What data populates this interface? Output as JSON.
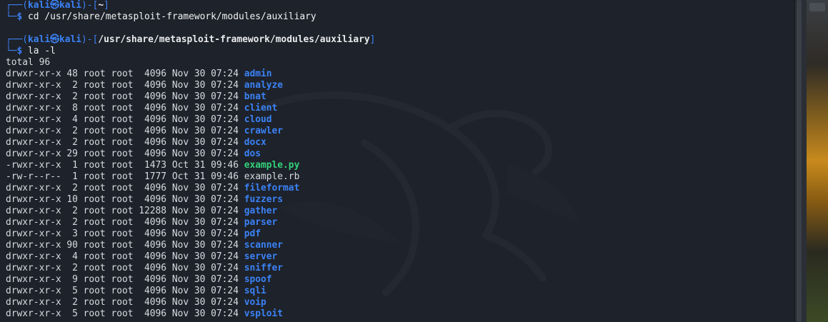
{
  "prompt1": {
    "corner_top": "┌──(",
    "user": "kali㉿kali",
    "sep": ")-[",
    "path": "~",
    "close": "]",
    "corner_bottom": "└─$ ",
    "command": "cd /usr/share/metasploit-framework/modules/auxiliary"
  },
  "prompt2": {
    "corner_top": "┌──(",
    "user": "kali㉿kali",
    "sep": ")-[",
    "path": "/usr/share/metasploit-framework/modules/auxiliary",
    "close": "]",
    "corner_bottom": "└─$ ",
    "command": "la -l"
  },
  "total": "total 96",
  "listing": [
    {
      "meta": "drwxr-xr-x 48 root root  4096 Nov 30 07:24 ",
      "name": "admin",
      "kind": "dir"
    },
    {
      "meta": "drwxr-xr-x  2 root root  4096 Nov 30 07:24 ",
      "name": "analyze",
      "kind": "dir"
    },
    {
      "meta": "drwxr-xr-x  2 root root  4096 Nov 30 07:24 ",
      "name": "bnat",
      "kind": "dir"
    },
    {
      "meta": "drwxr-xr-x  8 root root  4096 Nov 30 07:24 ",
      "name": "client",
      "kind": "dir"
    },
    {
      "meta": "drwxr-xr-x  4 root root  4096 Nov 30 07:24 ",
      "name": "cloud",
      "kind": "dir"
    },
    {
      "meta": "drwxr-xr-x  2 root root  4096 Nov 30 07:24 ",
      "name": "crawler",
      "kind": "dir"
    },
    {
      "meta": "drwxr-xr-x  2 root root  4096 Nov 30 07:24 ",
      "name": "docx",
      "kind": "dir"
    },
    {
      "meta": "drwxr-xr-x 29 root root  4096 Nov 30 07:24 ",
      "name": "dos",
      "kind": "dir"
    },
    {
      "meta": "-rwxr-xr-x  1 root root  1473 Oct 31 09:46 ",
      "name": "example.py",
      "kind": "exe"
    },
    {
      "meta": "-rw-r--r--  1 root root  1777 Oct 31 09:46 ",
      "name": "example.rb",
      "kind": "file"
    },
    {
      "meta": "drwxr-xr-x  2 root root  4096 Nov 30 07:24 ",
      "name": "fileformat",
      "kind": "dir"
    },
    {
      "meta": "drwxr-xr-x 10 root root  4096 Nov 30 07:24 ",
      "name": "fuzzers",
      "kind": "dir"
    },
    {
      "meta": "drwxr-xr-x  2 root root 12288 Nov 30 07:24 ",
      "name": "gather",
      "kind": "dir"
    },
    {
      "meta": "drwxr-xr-x  2 root root  4096 Nov 30 07:24 ",
      "name": "parser",
      "kind": "dir"
    },
    {
      "meta": "drwxr-xr-x  3 root root  4096 Nov 30 07:24 ",
      "name": "pdf",
      "kind": "dir"
    },
    {
      "meta": "drwxr-xr-x 90 root root  4096 Nov 30 07:24 ",
      "name": "scanner",
      "kind": "dir"
    },
    {
      "meta": "drwxr-xr-x  4 root root  4096 Nov 30 07:24 ",
      "name": "server",
      "kind": "dir"
    },
    {
      "meta": "drwxr-xr-x  2 root root  4096 Nov 30 07:24 ",
      "name": "sniffer",
      "kind": "dir"
    },
    {
      "meta": "drwxr-xr-x  9 root root  4096 Nov 30 07:24 ",
      "name": "spoof",
      "kind": "dir"
    },
    {
      "meta": "drwxr-xr-x  5 root root  4096 Nov 30 07:24 ",
      "name": "sqli",
      "kind": "dir"
    },
    {
      "meta": "drwxr-xr-x  2 root root  4096 Nov 30 07:24 ",
      "name": "voip",
      "kind": "dir"
    },
    {
      "meta": "drwxr-xr-x  5 root root  4096 Nov 30 07:24 ",
      "name": "vsploit",
      "kind": "dir"
    }
  ],
  "colors": {
    "background": "#1e222a",
    "prompt_blue": "#3b82f6",
    "directory": "#3b82f6",
    "executable": "#33d17a",
    "text": "#d7dae0"
  },
  "icons": {
    "watermark": "kali-dragon-icon"
  }
}
